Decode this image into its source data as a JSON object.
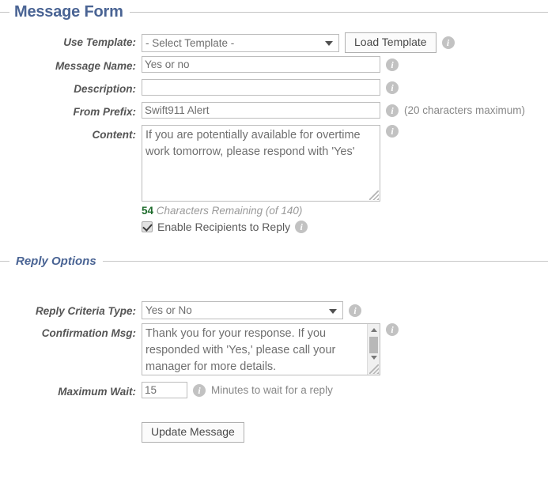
{
  "sections": {
    "message_form": {
      "title": "Message Form"
    },
    "reply_options": {
      "title": "Reply Options"
    }
  },
  "message_form": {
    "use_template": {
      "label": "Use Template:",
      "selected": "- Select Template -",
      "options": [
        "- Select Template -"
      ],
      "load_button": "Load Template",
      "info": "i"
    },
    "message_name": {
      "label": "Message Name:",
      "value": "Yes or no",
      "placeholder": "",
      "info": "i"
    },
    "description": {
      "label": "Description:",
      "value": "",
      "placeholder": "",
      "info": "i"
    },
    "from_prefix": {
      "label": "From Prefix:",
      "value": "Swift911 Alert",
      "placeholder": "",
      "info": "i",
      "hint": "(20 characters maximum)"
    },
    "content": {
      "label": "Content:",
      "value": "If you are potentially available for overtime work tomorrow, please respond with 'Yes'",
      "info": "i"
    },
    "characters": {
      "remaining": "54",
      "text": "Characters Remaining (of 140)"
    },
    "enable_reply": {
      "label": "Enable Recipients to Reply",
      "checked": true,
      "info": "i"
    }
  },
  "reply_options": {
    "criteria_type": {
      "label": "Reply Criteria Type:",
      "selected": "Yes or No",
      "options": [
        "Yes or No"
      ],
      "info": "i"
    },
    "confirmation_msg": {
      "label": "Confirmation Msg:",
      "value": "Thank you for your response. If you responded with 'Yes,' please call your manager for more details.",
      "info": "i"
    },
    "maximum_wait": {
      "label": "Maximum Wait:",
      "value": "15",
      "info": "i",
      "hint": "Minutes to wait for a reply"
    }
  },
  "actions": {
    "update_message": "Update Message"
  },
  "colors": {
    "legend": "#4a6494",
    "label": "#555555",
    "field_text": "#6f6f6f",
    "info_icon": "#c2c2c2",
    "chars_count": "#1d6b2b",
    "rule": "#c6c6c6"
  }
}
